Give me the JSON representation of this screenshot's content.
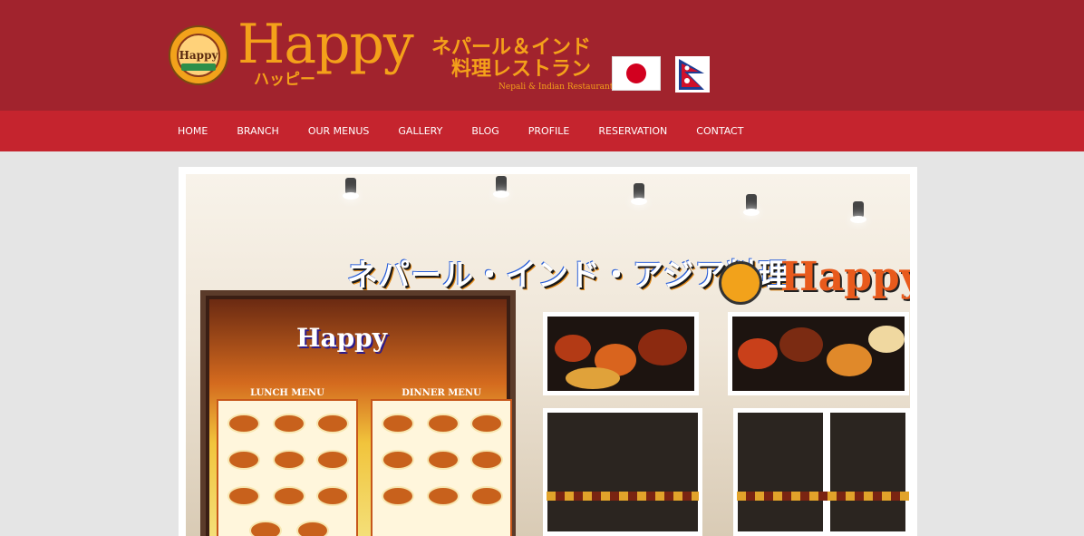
{
  "header": {
    "emblem_text": "Happy",
    "brand": "Happy",
    "brand_kana": "ハッピー",
    "tagline_line1": "ネパール＆インド",
    "tagline_line2": "料理レストラン",
    "tagline_en": "Nepali & Indian Restaurant",
    "flags": [
      "japan-flag",
      "nepal-flag"
    ]
  },
  "nav": {
    "items": [
      {
        "label": "HOME"
      },
      {
        "label": "BRANCH"
      },
      {
        "label": "OUR MENUS"
      },
      {
        "label": "GALLERY"
      },
      {
        "label": "BLOG"
      },
      {
        "label": "PROFILE"
      },
      {
        "label": "RESERVATION"
      },
      {
        "label": "CONTACT"
      }
    ]
  },
  "photo": {
    "sign_text": "ネパール・インド・アジア料理",
    "sign_brand": "Happy",
    "board_title": "Happy",
    "board_lunch": "LUNCH MENU",
    "board_dinner": "DINNER MENU"
  },
  "colors": {
    "header_bg": "#a1232d",
    "nav_bg": "#c5242e",
    "brand_orange": "#f4a11a",
    "page_bg": "#e5e5e5"
  }
}
